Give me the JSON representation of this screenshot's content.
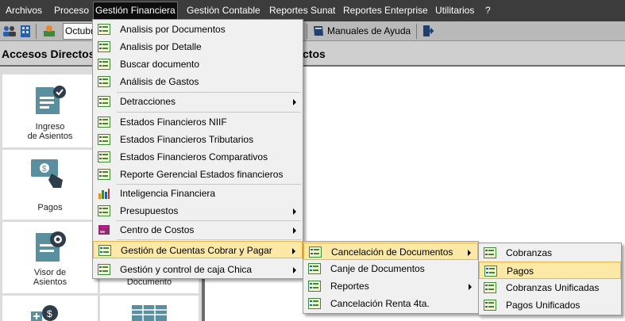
{
  "menubar": {
    "items": [
      {
        "label": "Archivos"
      },
      {
        "label": "Proceso"
      },
      {
        "label": "Gestión Financiera"
      },
      {
        "label": "Gestión Contable"
      },
      {
        "label": "Reportes Sunat"
      },
      {
        "label": "Reportes Enterprise"
      },
      {
        "label": "Utilitarios"
      },
      {
        "label": "?"
      }
    ]
  },
  "toolbar": {
    "period_value": "Octubre",
    "manual_label": "Manuales de Ayuda"
  },
  "left_panel": {
    "title": "Accesos Directos",
    "tiles": [
      {
        "label_1": "Ingreso",
        "label_2": "de Asientos",
        "icon": "document-check-icon"
      },
      {
        "label_1": "Pagos",
        "label_2": "",
        "icon": "payment-hand-icon"
      },
      {
        "label_1": "Visor de",
        "label_2": "Asientos",
        "icon": "document-view-icon"
      },
      {
        "label_1": "",
        "label_2": "",
        "icon": "add-money-icon"
      }
    ],
    "second_col_tiles": [
      {
        "label": "Documento"
      },
      {
        "label": "",
        "icon": "table-icon"
      }
    ]
  },
  "right_panel": {
    "title_fragment": "ctos"
  },
  "menu_financiera": {
    "items": [
      {
        "label": "Analisis por Documentos",
        "icon": "menu-item-icon"
      },
      {
        "label": "Analisis por Detalle",
        "icon": "menu-item-icon"
      },
      {
        "label": "Buscar documento",
        "icon": "menu-item-icon"
      },
      {
        "label": "Análisis de Gastos",
        "icon": "menu-item-icon"
      },
      {
        "label": "Detracciones",
        "icon": "menu-item-icon",
        "submenu": true
      },
      {
        "label": "Estados Financieros NIIF",
        "icon": "menu-item-icon"
      },
      {
        "label": "Estados Financieros Tributarios",
        "icon": "menu-item-icon"
      },
      {
        "label": "Estados Financieros Comparativos",
        "icon": "menu-item-icon"
      },
      {
        "label": "Reporte Gerencial Estados financieros",
        "icon": "menu-item-icon"
      },
      {
        "label": "Inteligencia Financiera",
        "icon": "bar-chart-icon"
      },
      {
        "label": "Presupuestos",
        "icon": "menu-item-icon",
        "submenu": true
      },
      {
        "label": "Centro de Costos",
        "icon": "cost-center-icon",
        "submenu": true
      },
      {
        "label": "Gestión de Cuentas Cobrar y Pagar",
        "icon": "menu-item-icon",
        "submenu": true,
        "highlighted": true
      },
      {
        "label": "Gestión y control de caja Chica",
        "icon": "menu-item-icon",
        "submenu": true
      }
    ]
  },
  "menu_cuentas": {
    "items": [
      {
        "label": "Cancelación de Documentos",
        "submenu": true,
        "highlighted": true
      },
      {
        "label": "Canje de Documentos"
      },
      {
        "label": "Reportes",
        "submenu": true
      },
      {
        "label": "Cancelación Renta 4ta."
      }
    ]
  },
  "menu_cancelacion": {
    "items": [
      {
        "label": "Cobranzas"
      },
      {
        "label": "Pagos",
        "highlighted": true
      },
      {
        "label": "Cobranzas Unificadas"
      },
      {
        "label": "Pagos Unificados"
      }
    ]
  },
  "colors": {
    "menubar_bg": "#3c3c3c",
    "toolbar_bg": "#b9b9b9",
    "highlight_bg": "#fce9a8",
    "highlight_border": "#e6b54a",
    "menu_bg": "#f0f0f0"
  }
}
